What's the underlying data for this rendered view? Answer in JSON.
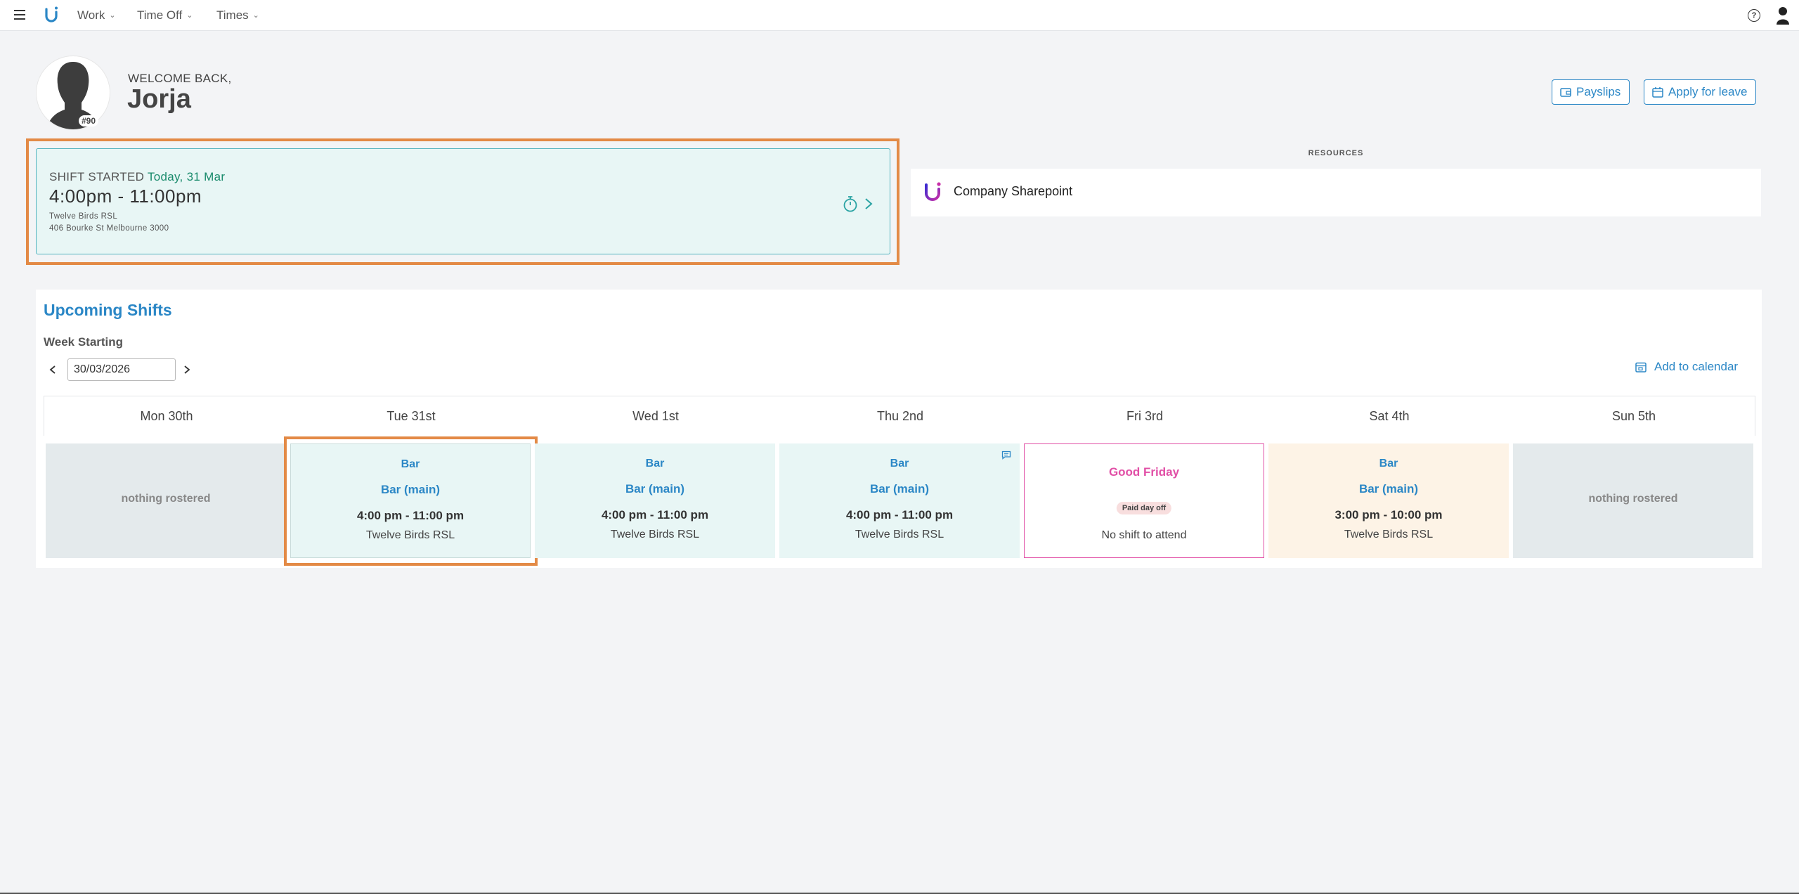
{
  "nav": {
    "items": [
      {
        "label": "Work"
      },
      {
        "label": "Time Off"
      },
      {
        "label": "Times"
      }
    ]
  },
  "header": {
    "welcome": "WELCOME BACK,",
    "name": "Jorja",
    "avatar_badge": "#90",
    "payslips_label": "Payslips",
    "apply_leave_label": "Apply for leave"
  },
  "current_shift": {
    "label": "SHIFT STARTED",
    "date": "Today, 31 Mar",
    "time": "4:00pm - 11:00pm",
    "venue": "Twelve Birds RSL",
    "address": "406 Bourke St Melbourne 3000"
  },
  "resources": {
    "title": "RESOURCES",
    "items": [
      {
        "label": "Company Sharepoint"
      }
    ]
  },
  "upcoming": {
    "title": "Upcoming Shifts",
    "week_label": "Week Starting",
    "week_value": "30/03/2026",
    "add_calendar_label": "Add to calendar",
    "days": [
      {
        "heading": "Mon 30th",
        "type": "empty",
        "text": "nothing rostered"
      },
      {
        "heading": "Tue 31st",
        "type": "shift",
        "role": "Bar",
        "area": "Bar (main)",
        "time": "4:00 pm - 11:00 pm",
        "venue": "Twelve Birds RSL"
      },
      {
        "heading": "Wed 1st",
        "type": "shift",
        "role": "Bar",
        "area": "Bar (main)",
        "time": "4:00 pm - 11:00 pm",
        "venue": "Twelve Birds RSL"
      },
      {
        "heading": "Thu 2nd",
        "type": "shift",
        "role": "Bar",
        "area": "Bar (main)",
        "time": "4:00 pm - 11:00 pm",
        "venue": "Twelve Birds RSL"
      },
      {
        "heading": "Fri 3rd",
        "type": "holiday",
        "holiday": "Good Friday",
        "badge": "Paid day off",
        "note": "No shift to attend"
      },
      {
        "heading": "Sat 4th",
        "type": "shift",
        "role": "Bar",
        "area": "Bar (main)",
        "time": "3:00 pm - 10:00 pm",
        "venue": "Twelve Birds RSL"
      },
      {
        "heading": "Sun 5th",
        "type": "empty",
        "text": "nothing rostered"
      }
    ]
  },
  "colors": {
    "accent": "#2b87c6",
    "highlight": "#e38a46",
    "holiday": "#e14fa6",
    "shift_bg": "#e8f6f5"
  }
}
